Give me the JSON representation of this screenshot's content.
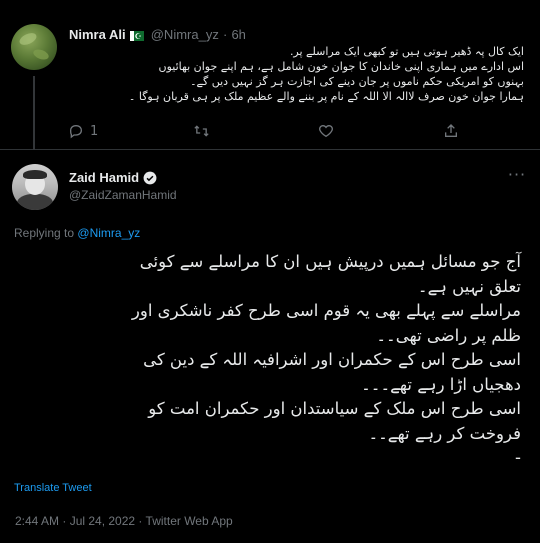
{
  "parent_tweet": {
    "display_name": "Nimra Ali",
    "handle": "@Nimra_yz",
    "separator": "·",
    "time_ago": "6h",
    "text_lines": [
      "ایک کال پہ ڈھیر ہوتی ہیں تو کبھی ایک مراسلے پر.",
      "اس ادارے میں ہماری اپنی خاندان کا جوان خون شامل ہے، ہم اپنے جوان بھائیوں",
      "بہنوں کو امریکی حکم ناموں پر جان دینے کی اجازت ہر گز نہیں دیں گے۔",
      "ہمارا جوان خون صرف لاالہ الا اللہ کے نام پر بننے والے عظیم ملک پر ہی قربان ہوگا ۔"
    ],
    "actions": {
      "reply_count": "1",
      "retweet_count": "",
      "like_count": ""
    }
  },
  "main_tweet": {
    "display_name": "Zaid Hamid",
    "handle": "@ZaidZamanHamid",
    "replying_prefix": "Replying to",
    "replying_to": "@Nimra_yz",
    "text_lines": [
      "آج جو مسائل ہمیں درپیش ہیں ان کا مراسلے سے کوئی",
      "تعلق نہیں ہے۔",
      "مراسلے سے پہلے بھی یہ قوم اسی طرح کفر ناشکری اور",
      "ظلم پر راضی تھی۔۔",
      "اسی طرح اس کے حکمران اور اشرافیہ اللہ کے دین کی",
      "دھجیاں اڑا رہے تھے۔۔۔",
      "اسی طرح اس ملک کے سیاستدان اور حکمران امت کو",
      "فروخت کر رہے تھے۔۔",
      "-"
    ],
    "translate_label": "Translate Tweet",
    "timestamp": "2:44 AM · Jul 24, 2022 · Twitter Web App"
  },
  "colors": {
    "background": "#000000",
    "text_primary": "#e7e9ea",
    "text_muted": "#71767b",
    "accent": "#1d9bf0",
    "divider": "#2f3336"
  },
  "icons": {
    "reply": "reply-icon",
    "retweet": "retweet-icon",
    "like": "heart-icon",
    "share": "share-icon",
    "verified": "verified-badge-icon",
    "more": "more-icon",
    "flag": "pakistan-flag-icon"
  }
}
